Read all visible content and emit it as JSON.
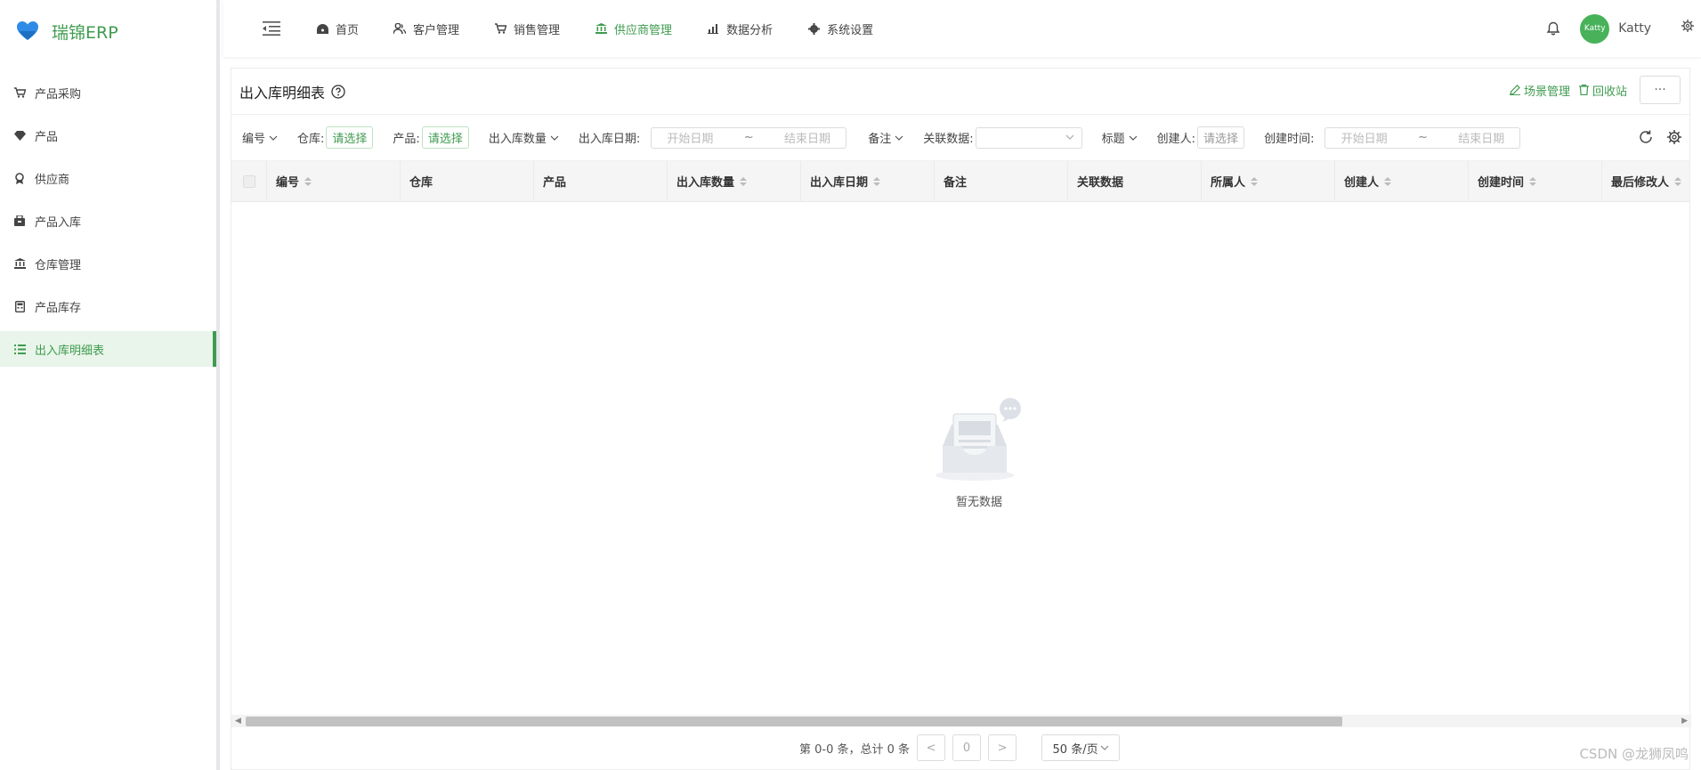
{
  "app": {
    "name": "瑞锦ERP"
  },
  "sidebar": {
    "items": [
      {
        "label": "产品采购"
      },
      {
        "label": "产品"
      },
      {
        "label": "供应商"
      },
      {
        "label": "产品入库"
      },
      {
        "label": "仓库管理"
      },
      {
        "label": "产品库存"
      },
      {
        "label": "出入库明细表"
      }
    ],
    "active_index": 6
  },
  "nav": {
    "tabs": [
      {
        "label": "首页"
      },
      {
        "label": "客户管理"
      },
      {
        "label": "销售管理"
      },
      {
        "label": "供应商管理"
      },
      {
        "label": "数据分析"
      },
      {
        "label": "系统设置"
      }
    ],
    "active_index": 3,
    "user": {
      "avatar_text": "Katty",
      "name": "Katty"
    }
  },
  "page": {
    "title": "出入库明细表",
    "actions": {
      "scene": "场景管理",
      "recycle": "回收站",
      "more": "···"
    }
  },
  "filters": {
    "code": "编号",
    "warehouse_label": "仓库:",
    "warehouse_value": "请选择",
    "product_label": "产品:",
    "product_value": "请选择",
    "qty": "出入库数量",
    "date_label": "出入库日期:",
    "date_start": "开始日期",
    "date_sep": "~",
    "date_end": "结束日期",
    "remark": "备注",
    "related_label": "关联数据:",
    "title": "标题",
    "creator_label": "创建人:",
    "creator_value": "请选择",
    "ctime_label": "创建时间:",
    "ctime_start": "开始日期",
    "ctime_sep": "~",
    "ctime_end": "结束日期"
  },
  "table": {
    "columns": [
      {
        "label": "编号",
        "sortable": true
      },
      {
        "label": "仓库",
        "sortable": false
      },
      {
        "label": "产品",
        "sortable": false
      },
      {
        "label": "出入库数量",
        "sortable": true
      },
      {
        "label": "出入库日期",
        "sortable": true
      },
      {
        "label": "备注",
        "sortable": false
      },
      {
        "label": "关联数据",
        "sortable": false
      },
      {
        "label": "所属人",
        "sortable": true
      },
      {
        "label": "创建人",
        "sortable": true
      },
      {
        "label": "创建时间",
        "sortable": true
      },
      {
        "label": "最后修改人",
        "sortable": true
      }
    ],
    "empty_text": "暂无数据"
  },
  "pager": {
    "summary": "第 0-0 条，总计 0 条",
    "prev": "<",
    "current": "0",
    "next": ">",
    "page_size": "50 条/页"
  },
  "watermark": "CSDN @龙狮凤鸣",
  "colors": {
    "accent": "#3f9b4f",
    "avatar": "#47b25a",
    "logo_heart": "#2f8be6"
  }
}
